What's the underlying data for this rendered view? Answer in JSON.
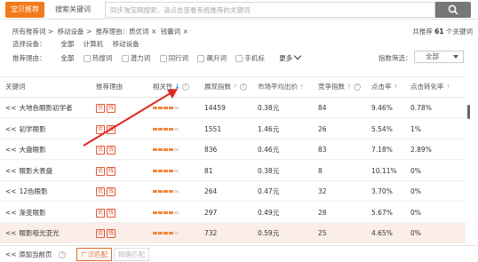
{
  "topbar": {
    "tab_active": "宝贝推荐",
    "tab_other": "搜索关键词",
    "search_placeholder": "同步淘宝网搜索，请点击查看系统推荐的关键词",
    "search_icon": "search-icon"
  },
  "breadcrumb": {
    "items": [
      "所有推荐词 >",
      "移动设备 >",
      "推荐理由：质优词 ×",
      "钱囊词 ×"
    ],
    "count_prefix": "共推荐",
    "count_value": "61",
    "count_suffix": "个关键词"
  },
  "filters": {
    "device_label": "选择设备：",
    "device_options": [
      "全部",
      "计算机",
      "移动设备"
    ],
    "reason_label": "推荐理由：",
    "reason_options": [
      "全部",
      "热搜词",
      "潜力词",
      "同行词",
      "飙升词",
      "手机标"
    ],
    "more_label": "更多",
    "index_label": "指数筛选：",
    "index_value": "全部"
  },
  "table": {
    "headers": {
      "keyword": "关键词",
      "reason": "推荐理由",
      "relevance": "相关性",
      "impressions": "展现指数",
      "avg_bid": "市场平均出价",
      "competition": "竞争指数",
      "ctr": "点击率",
      "cvr": "点击转化率"
    },
    "rows": [
      {
        "prefix": "<<",
        "keyword": "大地色眼影初学者",
        "badge": "优",
        "impressions": "14459",
        "avg_bid": "0.38元",
        "competition": "84",
        "ctr": "9.46%",
        "cvr": "0.78%",
        "relevance": 0.8,
        "highlight": false
      },
      {
        "prefix": "<<",
        "keyword": "初学眼影",
        "badge": "优",
        "impressions": "1551",
        "avg_bid": "1.46元",
        "competition": "26",
        "ctr": "5.54%",
        "cvr": "1%",
        "relevance": 0.8,
        "highlight": false
      },
      {
        "prefix": "<<",
        "keyword": "大盘眼影",
        "badge": "优",
        "impressions": "836",
        "avg_bid": "0.46元",
        "competition": "83",
        "ctr": "7.18%",
        "cvr": "2.89%",
        "relevance": 0.8,
        "highlight": false
      },
      {
        "prefix": "<<",
        "keyword": "眼影大表盘",
        "badge": "优",
        "impressions": "81",
        "avg_bid": "0.38元",
        "competition": "8",
        "ctr": "10.11%",
        "cvr": "0%",
        "relevance": 0.8,
        "highlight": false
      },
      {
        "prefix": "<<",
        "keyword": "12色眼影",
        "badge": "优",
        "impressions": "264",
        "avg_bid": "0.47元",
        "competition": "32",
        "ctr": "3.70%",
        "cvr": "0%",
        "relevance": 0.8,
        "highlight": false
      },
      {
        "prefix": "<<",
        "keyword": "渐变眼影",
        "badge": "优",
        "impressions": "297",
        "avg_bid": "0.49元",
        "competition": "28",
        "ctr": "5.67%",
        "cvr": "0%",
        "relevance": 0.8,
        "highlight": false
      },
      {
        "prefix": "<<",
        "keyword": "眼影哑光亚光",
        "badge": "优",
        "impressions": "732",
        "avg_bid": "0.59元",
        "competition": "25",
        "ctr": "4.65%",
        "cvr": "0%",
        "relevance": 0.8,
        "highlight": true
      }
    ]
  },
  "bottombar": {
    "add_page": "<< 添加当前页",
    "broad_match": "广泛匹配",
    "exact_match": "精确匹配"
  },
  "colors": {
    "accent": "#f27a1a",
    "bar_on": "#f2873a",
    "bar_off": "#ddd",
    "annotation": "#e0271f"
  }
}
